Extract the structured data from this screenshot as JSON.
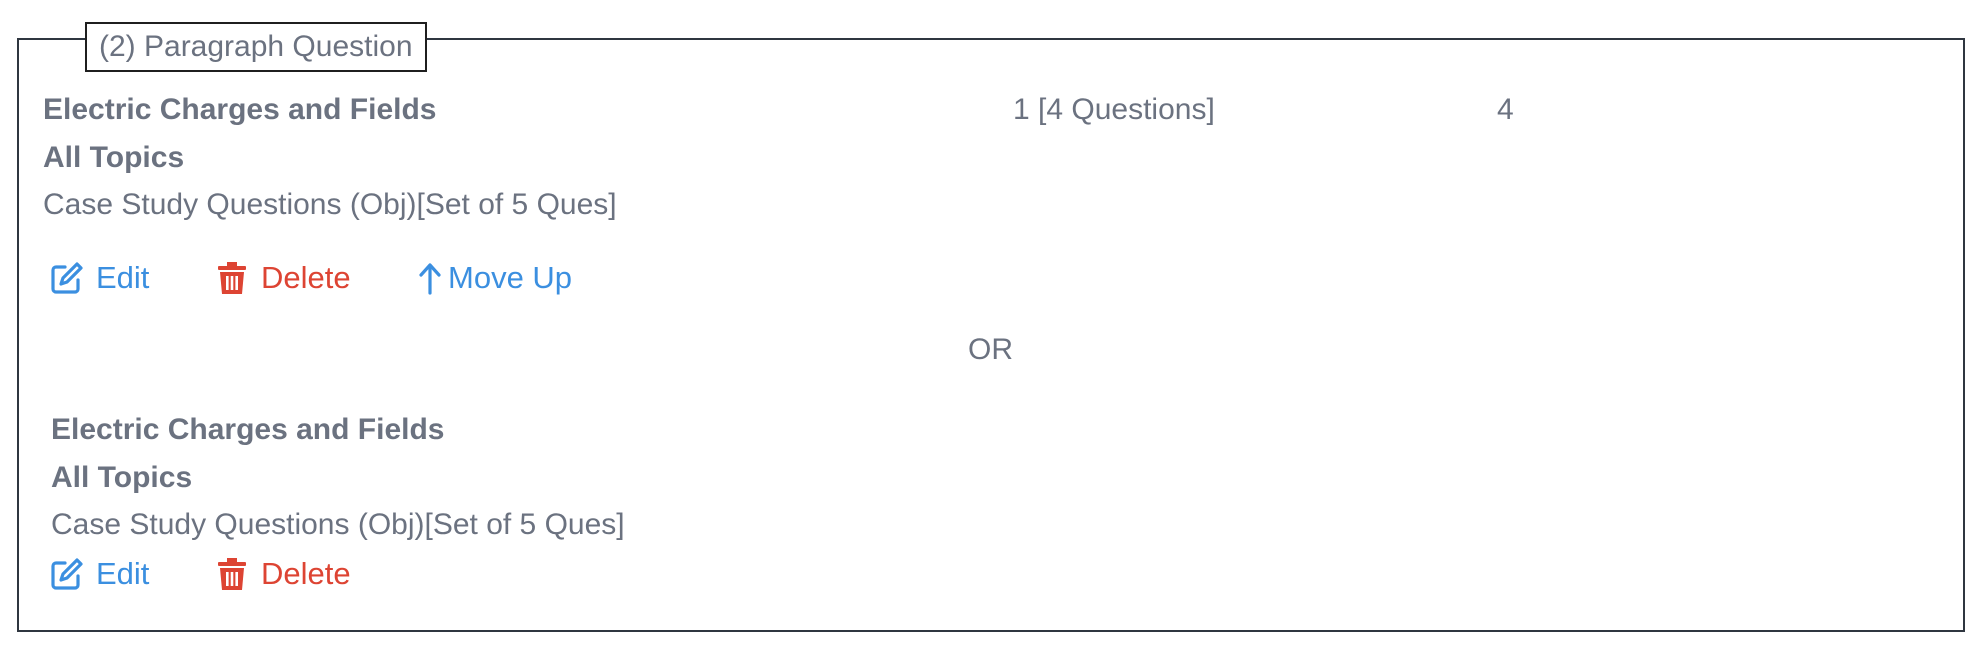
{
  "section": {
    "legend": "(2) Paragraph Question"
  },
  "first": {
    "chapter": "Electric Charges and Fields",
    "count": "1 [4 Questions]",
    "marks": "4",
    "topic": "All Topics",
    "type": "Case Study Questions (Obj)[Set of 5 Ques]",
    "actions": {
      "edit_label": "Edit",
      "delete_label": "Delete",
      "move_up_label": "Move Up"
    }
  },
  "separator": {
    "or_label": "OR"
  },
  "second": {
    "chapter": "Electric Charges and Fields",
    "topic": "All Topics",
    "type": "Case Study Questions (Obj)[Set of 5 Ques]",
    "actions": {
      "edit_label": "Edit",
      "delete_label": "Delete"
    }
  },
  "icons": {
    "edit": "edit-icon",
    "delete": "trash-icon",
    "move_up": "arrow-up-icon"
  },
  "colors": {
    "text": "#6b7280",
    "link_blue": "#3b8fe0",
    "delete_red": "#dd4433",
    "border": "#2f3640"
  }
}
